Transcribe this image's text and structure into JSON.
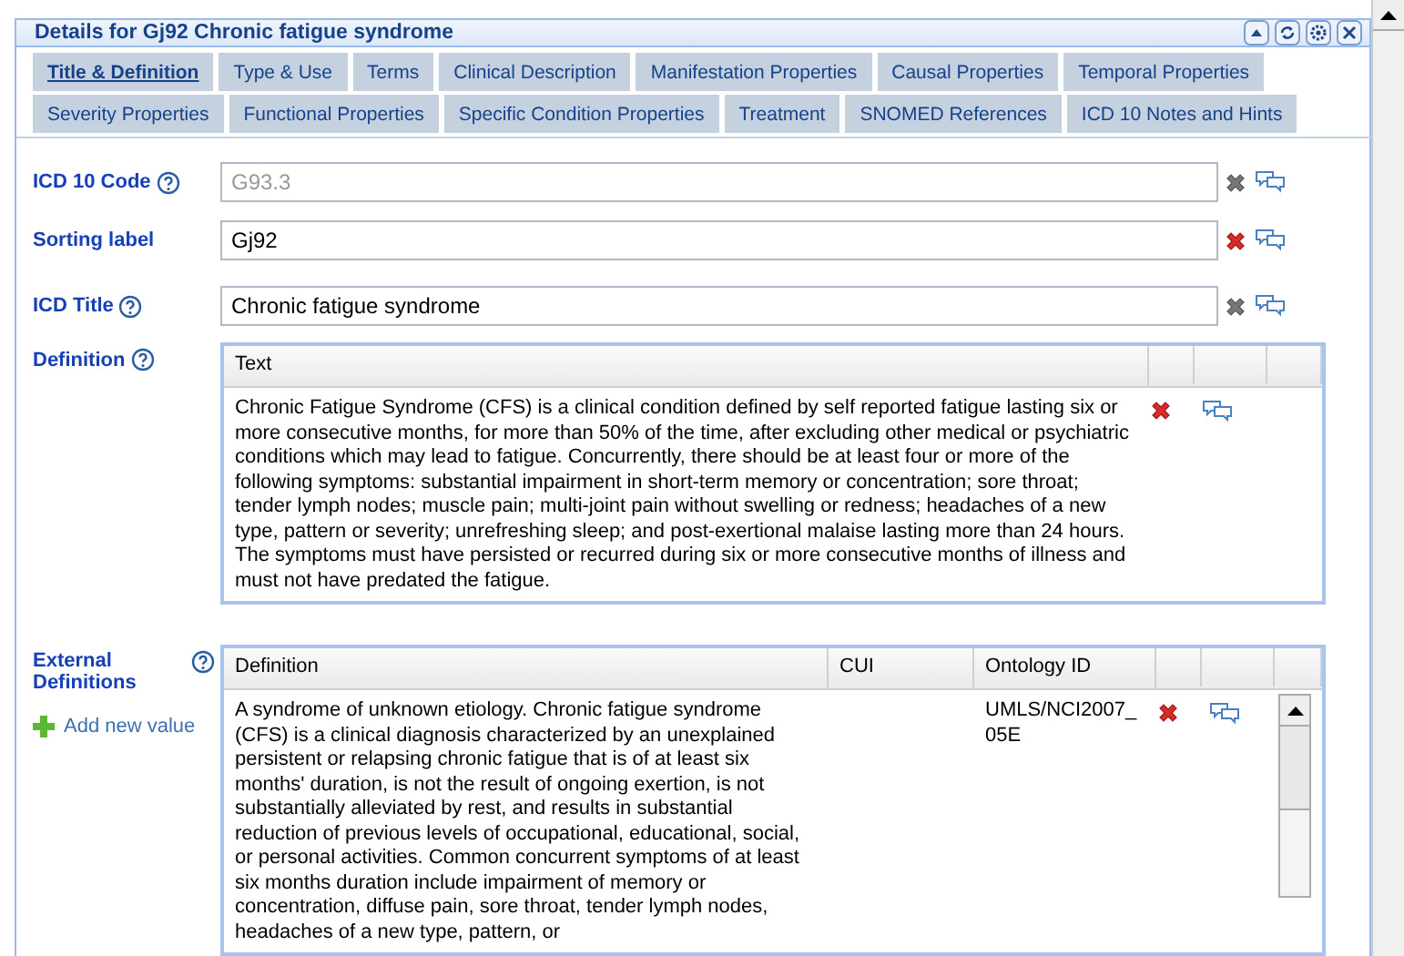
{
  "panel": {
    "title": "Details for Gj92 Chronic fatigue syndrome"
  },
  "tabs": [
    {
      "label": "Title & Definition",
      "selected": true
    },
    {
      "label": "Type & Use",
      "selected": false
    },
    {
      "label": "Terms",
      "selected": false
    },
    {
      "label": "Clinical Description",
      "selected": false
    },
    {
      "label": "Manifestation Properties",
      "selected": false
    },
    {
      "label": "Causal Properties",
      "selected": false
    },
    {
      "label": "Temporal Properties",
      "selected": false
    },
    {
      "label": "Severity Properties",
      "selected": false
    },
    {
      "label": "Functional Properties",
      "selected": false
    },
    {
      "label": "Specific Condition Properties",
      "selected": false
    },
    {
      "label": "Treatment",
      "selected": false
    },
    {
      "label": "SNOMED References",
      "selected": false
    },
    {
      "label": "ICD 10 Notes and Hints",
      "selected": false
    }
  ],
  "fields": [
    {
      "label": "ICD 10 Code",
      "help": true,
      "value": "G93.3",
      "disabled": true,
      "deletable": false
    },
    {
      "label": "Sorting label",
      "help": false,
      "value": "Gj92",
      "disabled": false,
      "deletable": true
    },
    {
      "label": "ICD Title",
      "help": true,
      "value": "Chronic fatigue syndrome",
      "disabled": false,
      "deletable": false
    }
  ],
  "definition": {
    "label": "Definition",
    "columns": [
      "Text"
    ],
    "rows": [
      {
        "text": "Chronic Fatigue Syndrome (CFS) is a clinical condition defined by self reported fatigue lasting six or more consecutive months, for more than 50% of the time, after excluding other medical or psychiatric conditions which may lead to fatigue. Concurrently, there should be at least four or more of the following symptoms: substantial impairment in short-term memory or concentration; sore throat; tender lymph nodes; muscle pain; multi-joint pain without swelling or redness; headaches of a new type, pattern or severity; unrefreshing sleep; and post-exertional malaise lasting more than 24 hours. The symptoms must have persisted or recurred during six or more consecutive months of illness and must not have predated the fatigue."
      }
    ]
  },
  "external_definitions": {
    "label": "External Definitions",
    "add_link": "Add new value",
    "columns": [
      "Definition",
      "CUI",
      "Ontology ID"
    ],
    "rows": [
      {
        "definition": "A syndrome of unknown etiology. Chronic fatigue syndrome (CFS) is a clinical diagnosis characterized by an unexplained persistent or relapsing chronic fatigue that is of at least six months' duration, is not the result of ongoing exertion, is not substantially alleviated by rest, and results in substantial reduction of previous levels of occupational, educational, social, or personal activities. Common concurrent symptoms of at least six months duration include impairment of memory or concentration, diffuse pain, sore throat, tender lymph nodes, headaches of a new type, pattern, or",
        "ontology_id": "UMLS/NCI2007_05E"
      }
    ]
  }
}
